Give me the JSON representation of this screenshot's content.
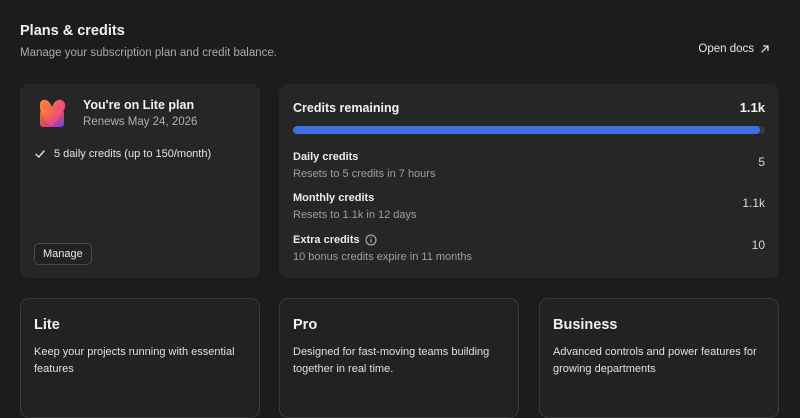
{
  "header": {
    "title": "Plans & credits",
    "subtitle": "Manage your subscription plan and credit balance.",
    "docs_link": "Open docs",
    "docs_icon": "arrow-up-right-icon"
  },
  "current_plan": {
    "logo_icon": "heart-logo-icon",
    "title": "You're on Lite plan",
    "renews": "Renews May 24, 2026",
    "features": [
      {
        "icon": "check-icon",
        "text": "5 daily credits (up to 150/month)"
      }
    ],
    "manage_label": "Manage"
  },
  "credits": {
    "title": "Credits remaining",
    "total": "1.1k",
    "progress_fraction": 0.99,
    "bar_color": "#3f6fe0",
    "rows": [
      {
        "label": "Daily credits",
        "sub": "Resets to 5 credits in 7 hours",
        "value": "5"
      },
      {
        "label": "Monthly credits",
        "sub": "Resets to 1.1k in 12 days",
        "value": "1.1k"
      },
      {
        "label": "Extra credits",
        "sub": "10 bonus credits expire in 11 months",
        "value": "10",
        "icon": "info-icon"
      }
    ]
  },
  "tiers": [
    {
      "name": "Lite",
      "description": "Keep your projects running with essential features"
    },
    {
      "name": "Pro",
      "description": "Designed for fast-moving teams building together in real time."
    },
    {
      "name": "Business",
      "description": "Advanced controls and power features for growing departments"
    }
  ]
}
